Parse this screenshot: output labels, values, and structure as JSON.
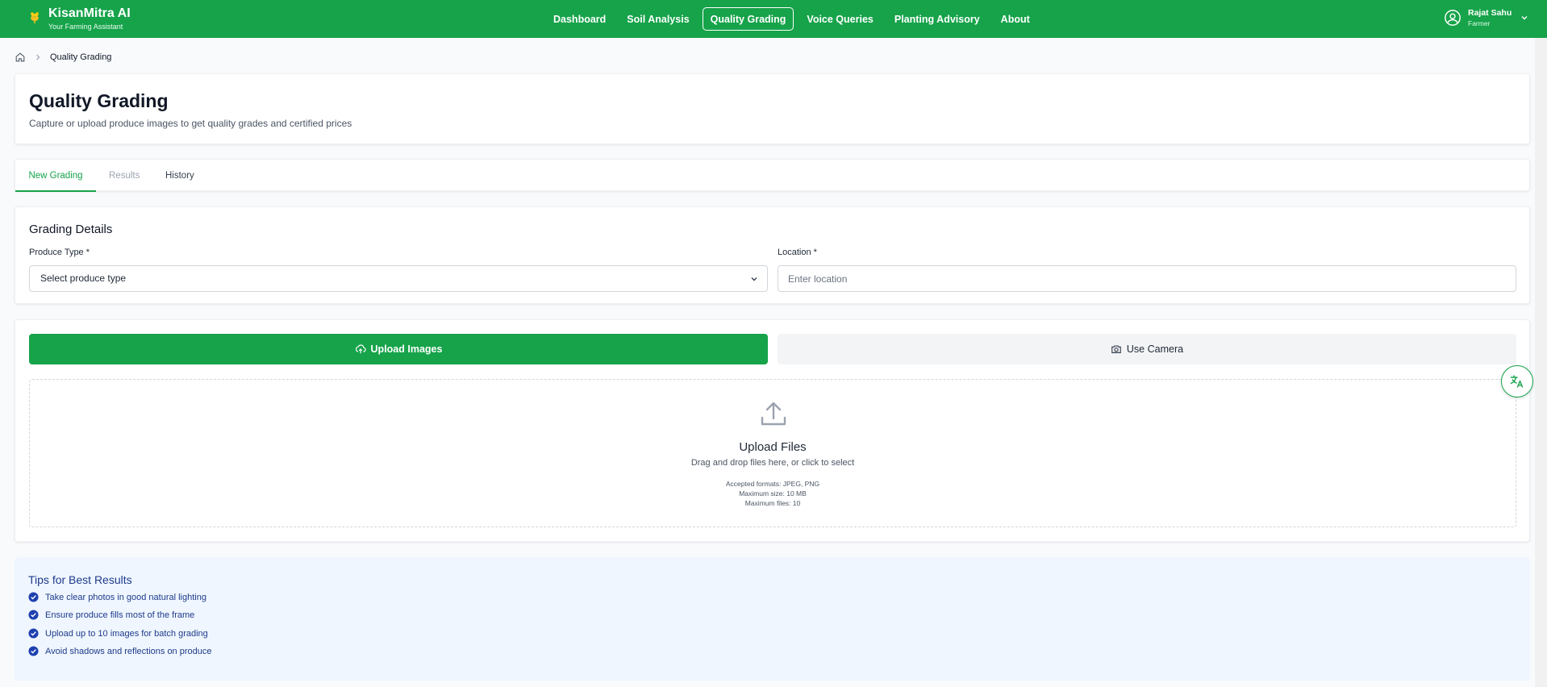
{
  "app": {
    "title": "KisanMitra AI",
    "subtitle": "Your Farming Assistant",
    "brand_color": "#16a34a"
  },
  "nav": {
    "items": [
      {
        "label": "Dashboard",
        "active": false
      },
      {
        "label": "Soil Analysis",
        "active": false
      },
      {
        "label": "Quality Grading",
        "active": true
      },
      {
        "label": "Voice Queries",
        "active": false
      },
      {
        "label": "Planting Advisory",
        "active": false
      },
      {
        "label": "About",
        "active": false
      }
    ]
  },
  "user": {
    "name": "Rajat Sahu",
    "role": "Farmer",
    "icon": "user-circle-icon"
  },
  "breadcrumb": {
    "current": "Quality Grading",
    "icon": "home-icon"
  },
  "page": {
    "title": "Quality Grading",
    "subtitle": "Capture or upload produce images to get quality grades and certified prices"
  },
  "tabs": [
    {
      "label": "New Grading",
      "active": true
    },
    {
      "label": "Results",
      "active": false,
      "disabled": true
    },
    {
      "label": "History",
      "active": false
    }
  ],
  "grading_details": {
    "title": "Grading Details",
    "produce_label": "Produce Type *",
    "produce_value": "Select produce type",
    "location_label": "Location *",
    "location_placeholder": "Enter location"
  },
  "upload": {
    "upload_button": "Upload Images",
    "camera_button": "Use Camera",
    "dropzone_title": "Upload Files",
    "dropzone_subtitle": "Drag and drop files here, or click to select",
    "formats": "Accepted formats: JPEG, PNG",
    "max_size": "Maximum size: 10 MB",
    "max_files": "Maximum files: 10"
  },
  "tips": {
    "title": "Tips for Best Results",
    "items": [
      "Take clear photos in good natural lighting",
      "Ensure produce fills most of the frame",
      "Upload up to 10 images for batch grading",
      "Avoid shadows and reflections on produce"
    ]
  },
  "floating": {
    "icon": "translate-icon"
  }
}
